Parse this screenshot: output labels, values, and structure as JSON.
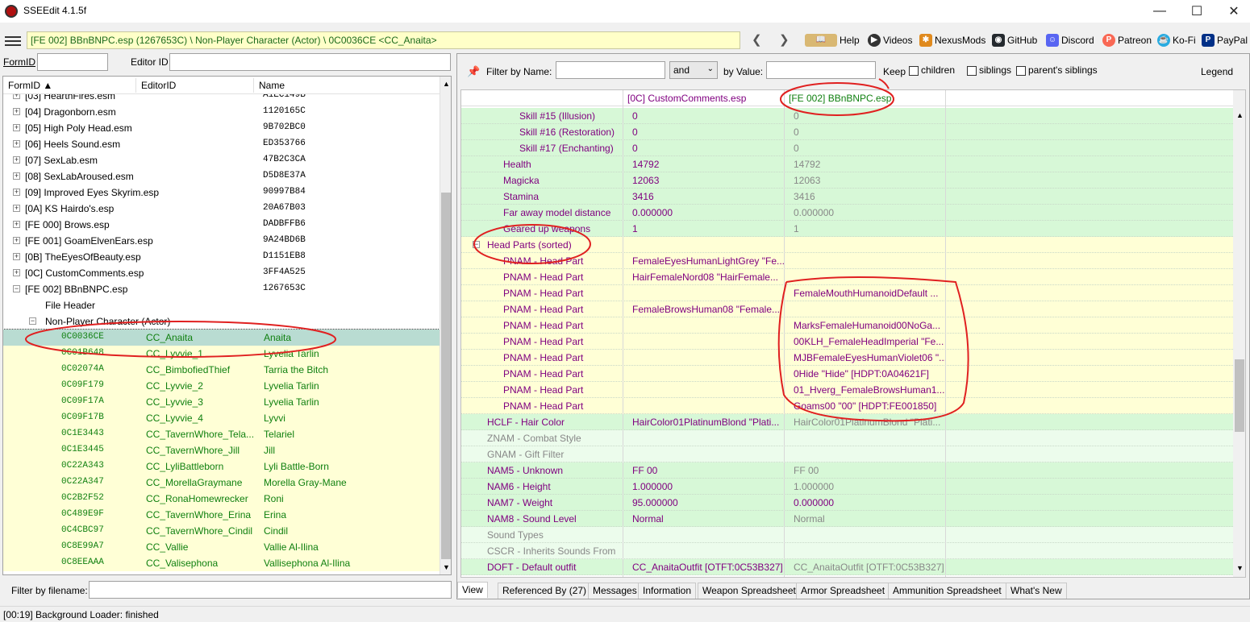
{
  "window": {
    "title": "SSEEdit 4.1.5f"
  },
  "path": {
    "text": "[FE 002] BBnBNPC.esp (1267653C) \\ Non-Player Character (Actor) \\ 0C0036CE <CC_Anaita>"
  },
  "toolbar": {
    "help": "Help",
    "videos": "Videos",
    "nexusmods": "NexusMods",
    "github": "GitHub",
    "discord": "Discord",
    "patreon": "Patreon",
    "kofi": "Ko-Fi",
    "paypal": "PayPal"
  },
  "left": {
    "formid_label": "FormID",
    "editorid_label": "Editor ID",
    "columns": [
      "FormID",
      "EditorID",
      "Name"
    ],
    "filter_label": "Filter by filename:",
    "files": [
      {
        "name": "[03] HearthFires.esm",
        "id": "A1EC149B"
      },
      {
        "name": "[04] Dragonborn.esm",
        "id": "1120165C"
      },
      {
        "name": "[05] High Poly Head.esm",
        "id": "9B702BC0"
      },
      {
        "name": "[06] Heels Sound.esm",
        "id": "ED353766"
      },
      {
        "name": "[07] SexLab.esm",
        "id": "47B2C3CA"
      },
      {
        "name": "[08] SexLabAroused.esm",
        "id": "D5D8E37A"
      },
      {
        "name": "[09] Improved Eyes Skyrim.esp",
        "id": "90997B84"
      },
      {
        "name": "[0A] KS Hairdo's.esp",
        "id": "20A67B03"
      },
      {
        "name": "[FE 000] Brows.esp",
        "id": "DADBFFB6"
      },
      {
        "name": "[FE 001] GoamElvenEars.esp",
        "id": "9A24BD6B"
      },
      {
        "name": "[0B] TheEyesOfBeauty.esp",
        "id": "D1151EB8"
      },
      {
        "name": "[0C] CustomComments.esp",
        "id": "3FF4A525"
      },
      {
        "name": "[FE 002] BBnBNPC.esp",
        "id": "1267653C"
      }
    ],
    "file_header": "File Header",
    "group": "Non-Player Character (Actor)",
    "records": [
      {
        "formid": "0C0036CE",
        "editorid": "CC_Anaita",
        "name": "Anaita"
      },
      {
        "formid": "0C01B648",
        "editorid": "CC_Lyvvie_1",
        "name": "Lyvelia Tarlin"
      },
      {
        "formid": "0C02074A",
        "editorid": "CC_BimbofiedThief",
        "name": "Tarria the Bitch"
      },
      {
        "formid": "0C09F179",
        "editorid": "CC_Lyvvie_2",
        "name": "Lyvelia Tarlin"
      },
      {
        "formid": "0C09F17A",
        "editorid": "CC_Lyvvie_3",
        "name": "Lyvelia Tarlin"
      },
      {
        "formid": "0C09F17B",
        "editorid": "CC_Lyvvie_4",
        "name": "Lyvvi"
      },
      {
        "formid": "0C1E3443",
        "editorid": "CC_TavernWhore_Tela...",
        "name": "Telariel"
      },
      {
        "formid": "0C1E3445",
        "editorid": "CC_TavernWhore_Jill",
        "name": "Jill"
      },
      {
        "formid": "0C22A343",
        "editorid": "CC_LyliBattleborn",
        "name": "Lyli Battle-Born"
      },
      {
        "formid": "0C22A347",
        "editorid": "CC_MorellaGraymane",
        "name": "Morella Gray-Mane"
      },
      {
        "formid": "0C2B2F52",
        "editorid": "CC_RonaHomewrecker",
        "name": "Roni"
      },
      {
        "formid": "0C489E9F",
        "editorid": "CC_TavernWhore_Erina",
        "name": "Erina"
      },
      {
        "formid": "0C4CBC97",
        "editorid": "CC_TavernWhore_Cindil",
        "name": "Cindil"
      },
      {
        "formid": "0C8E99A7",
        "editorid": "CC_Vallie",
        "name": "Vallie Al-Ilina"
      },
      {
        "formid": "0C8EEAAA",
        "editorid": "CC_Valisephona",
        "name": "Vallisephona Al-Ilina"
      }
    ]
  },
  "right": {
    "filter_name_label": "Filter by Name:",
    "and_select": "and",
    "by_value_label": "by Value:",
    "keep_label": "Keep",
    "children_label": "children",
    "siblings_label": "siblings",
    "parents_siblings_label": "parent's siblings",
    "legend": "Legend",
    "col1": "[0C] CustomComments.esp",
    "col2": "[FE 002] BBnBNPC.esp",
    "rows": [
      {
        "label": "Skill #15 (Illusion)",
        "v1": "0",
        "v2": "0"
      },
      {
        "label": "Skill #16 (Restoration)",
        "v1": "0",
        "v2": "0"
      },
      {
        "label": "Skill #17 (Enchanting)",
        "v1": "0",
        "v2": "0"
      },
      {
        "label": "Health",
        "v1": "14792",
        "v2": "14792"
      },
      {
        "label": "Magicka",
        "v1": "12063",
        "v2": "12063"
      },
      {
        "label": "Stamina",
        "v1": "3416",
        "v2": "3416"
      },
      {
        "label": "Far away model distance",
        "v1": "0.000000",
        "v2": "0.000000"
      },
      {
        "label": "Geared up weapons",
        "v1": "1",
        "v2": "1"
      },
      {
        "label": "Head Parts (sorted)",
        "v1": "",
        "v2": ""
      },
      {
        "label": "PNAM - Head Part",
        "v1": "FemaleEyesHumanLightGrey \"Fe...",
        "v2": ""
      },
      {
        "label": "PNAM - Head Part",
        "v1": "HairFemaleNord08 \"HairFemale...",
        "v2": ""
      },
      {
        "label": "PNAM - Head Part",
        "v1": "",
        "v2": "FemaleMouthHumanoidDefault ..."
      },
      {
        "label": "PNAM - Head Part",
        "v1": "FemaleBrowsHuman08 \"Female...",
        "v2": ""
      },
      {
        "label": "PNAM - Head Part",
        "v1": "",
        "v2": "MarksFemaleHumanoid00NoGa..."
      },
      {
        "label": "PNAM - Head Part",
        "v1": "",
        "v2": "00KLH_FemaleHeadImperial \"Fe..."
      },
      {
        "label": "PNAM - Head Part",
        "v1": "",
        "v2": "MJBFemaleEyesHumanViolet06 \"..."
      },
      {
        "label": "PNAM - Head Part",
        "v1": "",
        "v2": "0Hide \"Hide\" [HDPT:0A04621F]"
      },
      {
        "label": "PNAM - Head Part",
        "v1": "",
        "v2": "01_Hverg_FemaleBrowsHuman1..."
      },
      {
        "label": "PNAM - Head Part",
        "v1": "",
        "v2": "Goams00 \"00\" [HDPT:FE001850]"
      },
      {
        "label": "HCLF - Hair Color",
        "v1": "HairColor01PlatinumBlond \"Plati...",
        "v2": "HairColor01PlatinumBlond \"Plati..."
      },
      {
        "label": "ZNAM - Combat Style",
        "v1": "",
        "v2": ""
      },
      {
        "label": "GNAM - Gift Filter",
        "v1": "",
        "v2": ""
      },
      {
        "label": "NAM5 - Unknown",
        "v1": "FF 00",
        "v2": "FF 00"
      },
      {
        "label": "NAM6 - Height",
        "v1": "1.000000",
        "v2": "1.000000"
      },
      {
        "label": "NAM7 - Weight",
        "v1": "95.000000",
        "v2": "0.000000"
      },
      {
        "label": "NAM8 - Sound Level",
        "v1": "Normal",
        "v2": "Normal"
      },
      {
        "label": "Sound Types",
        "v1": "",
        "v2": ""
      },
      {
        "label": "CSCR - Inherits Sounds From",
        "v1": "",
        "v2": ""
      },
      {
        "label": "DOFT - Default outfit",
        "v1": "CC_AnaitaOutfit [OTFT:0C53B327]",
        "v2": "CC_AnaitaOutfit [OTFT:0C53B327]"
      }
    ],
    "tabs": [
      "View",
      "Referenced By (27)",
      "Messages",
      "Information",
      "Weapon Spreadsheet",
      "Armor Spreadsheet",
      "Ammunition Spreadsheet",
      "What's New"
    ]
  },
  "status": {
    "text": "[00:19] Background Loader: finished"
  }
}
